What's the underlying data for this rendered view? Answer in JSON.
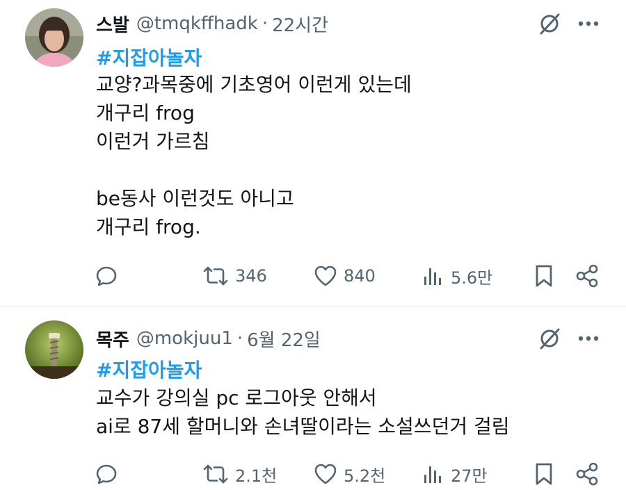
{
  "tweets": [
    {
      "name": "스발",
      "handle": "@tmqkffhadk",
      "sep": "·",
      "time": "22시간",
      "hashtag": "#지잡아놀자",
      "lines": [
        "교양?과목중에 기초영어 이런게 있는데",
        "개구리 frog",
        "이런거 가르침",
        "",
        "be동사 이런것도 아니고",
        "개구리 frog."
      ],
      "retweets": "346",
      "likes": "840",
      "views": "5.6만",
      "avatar_icon": "profile-photo"
    },
    {
      "name": "목주",
      "handle": "@mokjuu1",
      "sep": "·",
      "time": "6월 22일",
      "hashtag": "#지잡아놀자",
      "lines": [
        "교수가 강의실 pc 로그아웃 안해서",
        "ai로 87세 할머니와 손녀딸이라는 소설쓰던거 걸림"
      ],
      "retweets": "2.1천",
      "likes": "5.2천",
      "views": "27만",
      "avatar_icon": "screw-photo"
    }
  ],
  "icons": {
    "grok": "grok-icon",
    "more": "more-icon",
    "reply": "reply-icon",
    "retweet": "retweet-icon",
    "like": "like-icon",
    "views": "views-icon",
    "bookmark": "bookmark-icon",
    "share": "share-icon"
  },
  "colors": {
    "text": "#0f1419",
    "secondary": "#536471",
    "link": "#1d9bf0",
    "divider": "#e6ebee"
  }
}
